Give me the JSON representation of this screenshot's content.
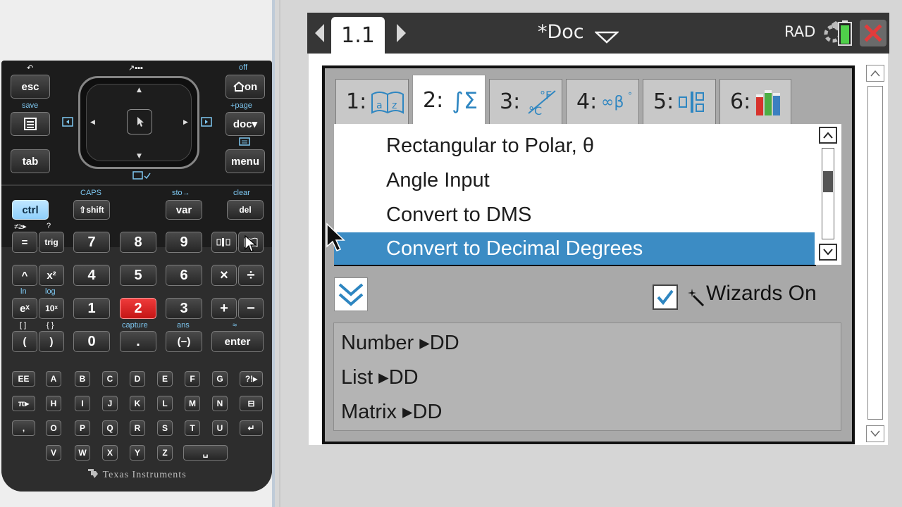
{
  "keypad": {
    "top_caps": [
      "↶",
      "↗▪▪▪",
      "off",
      "save",
      "+page"
    ],
    "esc": "esc",
    "home_on": "on",
    "scratch_icon": "calculator-icon",
    "doc": "doc▾",
    "tab": "tab",
    "menu": "menu",
    "caps_label": "CAPS",
    "sto_label": "sto→",
    "clear_label": "clear",
    "ctrl": "ctrl",
    "shift": "⇧shift",
    "var": "var",
    "del": "del",
    "row1": [
      "=",
      "trig",
      "7",
      "8",
      "9"
    ],
    "row1_caps": [
      "≠≥▸",
      "?"
    ],
    "row2": [
      "^",
      "x²",
      "4",
      "5",
      "6",
      "×",
      "÷"
    ],
    "row3": [
      "eˣ",
      "10ˣ",
      "1",
      "2",
      "3",
      "+",
      "−"
    ],
    "row3_caps": [
      "ln",
      "log"
    ],
    "row4": [
      "(",
      ")",
      "0",
      ".",
      "(−)",
      "enter"
    ],
    "row4_caps": [
      "[ ]",
      "{ }",
      "capture",
      "ans",
      "≈"
    ],
    "alpha_rows": [
      [
        "EE",
        "A",
        "B",
        "C",
        "D",
        "E",
        "F",
        "G",
        "?!▸"
      ],
      [
        "π▸",
        "H",
        "I",
        "J",
        "K",
        "L",
        "M",
        "N",
        "⊟"
      ],
      [
        ",",
        "O",
        "P",
        "Q",
        "R",
        "S",
        "T",
        "U",
        "↵"
      ],
      [
        "V",
        "W",
        "X",
        "Y",
        "Z",
        "␣"
      ]
    ],
    "brand": "Texas Instruments"
  },
  "titlebar": {
    "page_tab": "1.1",
    "doc_title": "*Doc",
    "mode": "RAD"
  },
  "catalog": {
    "tabs": [
      {
        "num": "1:",
        "icon": "book-icon"
      },
      {
        "num": "2:",
        "text": "∫Σ",
        "selected": true
      },
      {
        "num": "3:",
        "icon": "unit-conversion-icon"
      },
      {
        "num": "4:",
        "icon": "symbols-icon"
      },
      {
        "num": "5:",
        "icon": "templates-icon"
      },
      {
        "num": "6:",
        "icon": "library-icon"
      }
    ],
    "items": [
      "Rectangular to Polar, θ",
      "Angle Input",
      "Convert to DMS",
      "Convert to Decimal Degrees"
    ],
    "selected_index": 3,
    "wizards_label": "Wizards On",
    "wizards_checked": true,
    "syntax": [
      "Number ▸DD",
      "List ▸DD",
      "Matrix ▸DD"
    ]
  },
  "colors": {
    "selection": "#3c8cc4",
    "close": "#e23b3b",
    "ctrl_key": "#8fd0fb",
    "red_key": "#d92222"
  }
}
